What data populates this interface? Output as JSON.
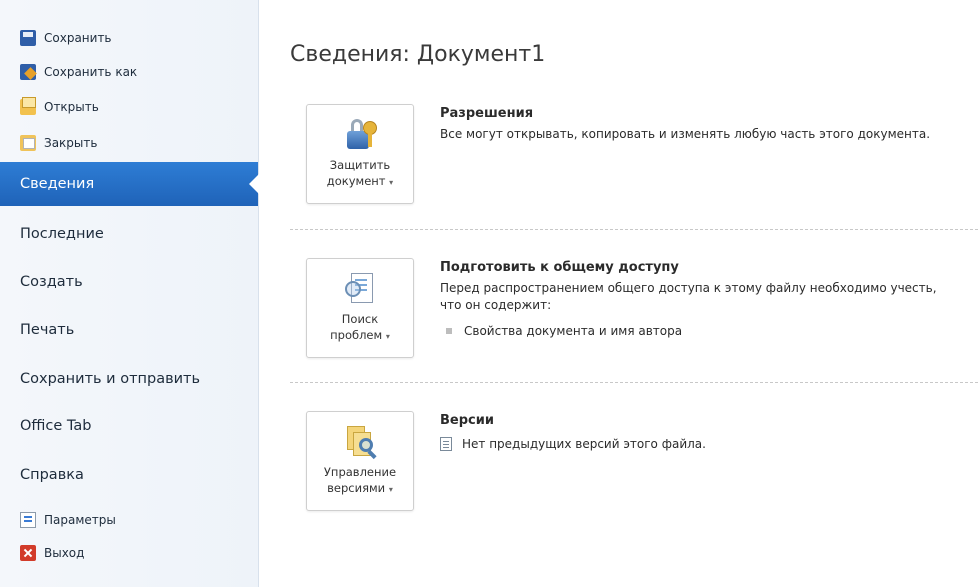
{
  "sidebar": {
    "top_items": [
      {
        "label": "Сохранить",
        "icon": "save-icon"
      },
      {
        "label": "Сохранить как",
        "icon": "save-as-icon"
      },
      {
        "label": "Открыть",
        "icon": "open-folder-icon"
      },
      {
        "label": "Закрыть",
        "icon": "close-folder-icon"
      }
    ],
    "nav_items": [
      {
        "label": "Сведения",
        "active": true
      },
      {
        "label": "Последние"
      },
      {
        "label": "Создать"
      },
      {
        "label": "Печать"
      },
      {
        "label": "Сохранить и отправить"
      },
      {
        "label": "Office Tab"
      },
      {
        "label": "Справка"
      }
    ],
    "bottom_items": [
      {
        "label": "Параметры",
        "icon": "options-icon"
      },
      {
        "label": "Выход",
        "icon": "exit-icon"
      }
    ],
    "active_color": "#2e7dd5"
  },
  "main": {
    "title": "Сведения: Документ1",
    "sections": [
      {
        "button": {
          "line1": "Защитить",
          "line2": "документ",
          "caret": "▾",
          "icon": "lock-key-icon"
        },
        "heading": "Разрешения",
        "text": "Все могут открывать, копировать и изменять любую часть этого документа."
      },
      {
        "button": {
          "line1": "Поиск",
          "line2": "проблем",
          "caret": "▾",
          "icon": "check-document-icon"
        },
        "heading": "Подготовить к общему доступу",
        "text": "Перед распространением общего доступа к этому файлу необходимо учесть, что он содержит:",
        "bullets": [
          "Свойства документа и имя автора"
        ]
      },
      {
        "button": {
          "line1": "Управление",
          "line2": "версиями",
          "caret": "▾",
          "icon": "versions-icon"
        },
        "heading": "Версии",
        "bullets": [
          "Нет предыдущих версий этого файла."
        ]
      }
    ]
  }
}
